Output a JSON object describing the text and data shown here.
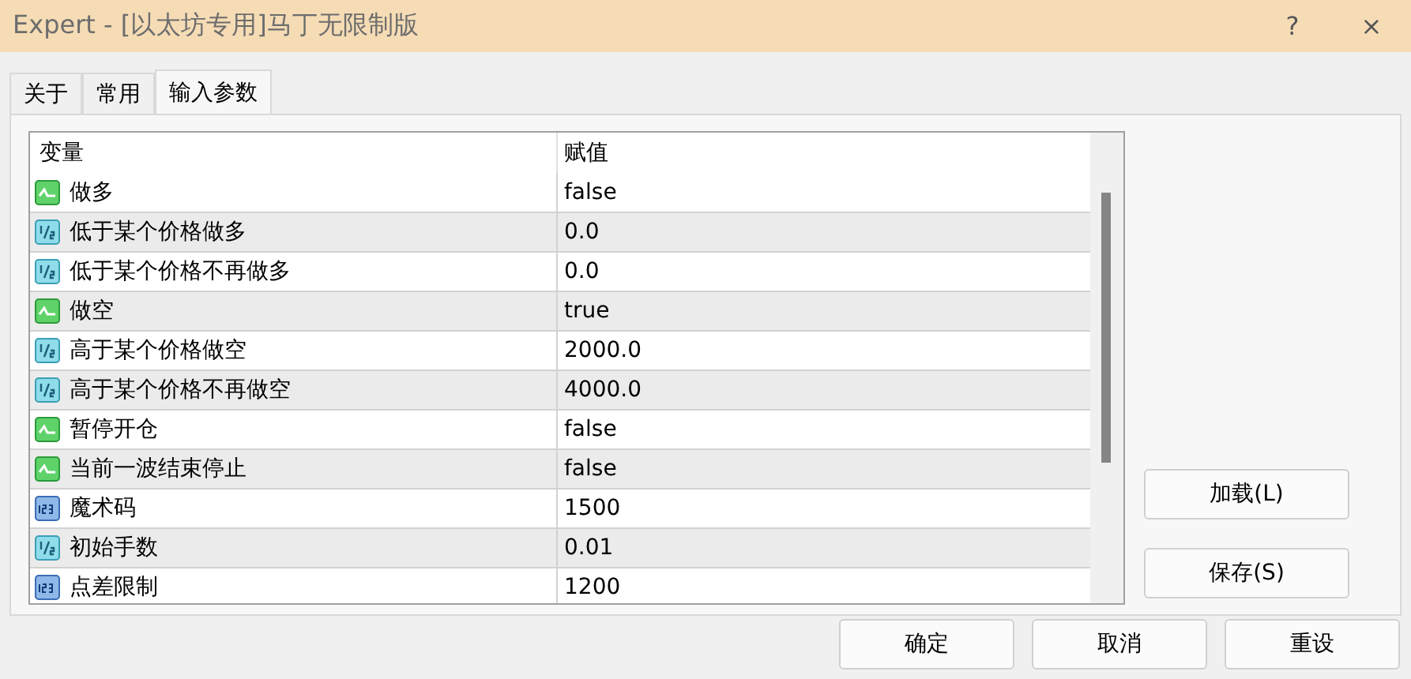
{
  "window": {
    "title": "Expert - [以太坊专用]马丁无限制版",
    "help": "?",
    "close": "×"
  },
  "tabs": [
    {
      "label": "关于",
      "selected": false
    },
    {
      "label": "常用",
      "selected": false
    },
    {
      "label": "输入参数",
      "selected": true
    }
  ],
  "table": {
    "columns": [
      "变量",
      "赋值"
    ],
    "rows": [
      {
        "kind": "bool",
        "name": "做多",
        "value": "false"
      },
      {
        "kind": "double",
        "name": "低于某个价格做多",
        "value": "0.0"
      },
      {
        "kind": "double",
        "name": "低于某个价格不再做多",
        "value": "0.0"
      },
      {
        "kind": "bool",
        "name": "做空",
        "value": "true"
      },
      {
        "kind": "double",
        "name": "高于某个价格做空",
        "value": "2000.0"
      },
      {
        "kind": "double",
        "name": "高于某个价格不再做空",
        "value": "4000.0"
      },
      {
        "kind": "bool",
        "name": "暂停开仓",
        "value": "false"
      },
      {
        "kind": "bool",
        "name": "当前一波结束停止",
        "value": "false"
      },
      {
        "kind": "int",
        "name": "魔术码",
        "value": "1500"
      },
      {
        "kind": "double",
        "name": "初始手数",
        "value": "0.01"
      },
      {
        "kind": "int",
        "name": "点差限制",
        "value": "1200"
      }
    ]
  },
  "side_buttons": [
    "加载(L)",
    "保存(S)"
  ],
  "buttons": [
    "确定",
    "取消",
    "重设"
  ]
}
